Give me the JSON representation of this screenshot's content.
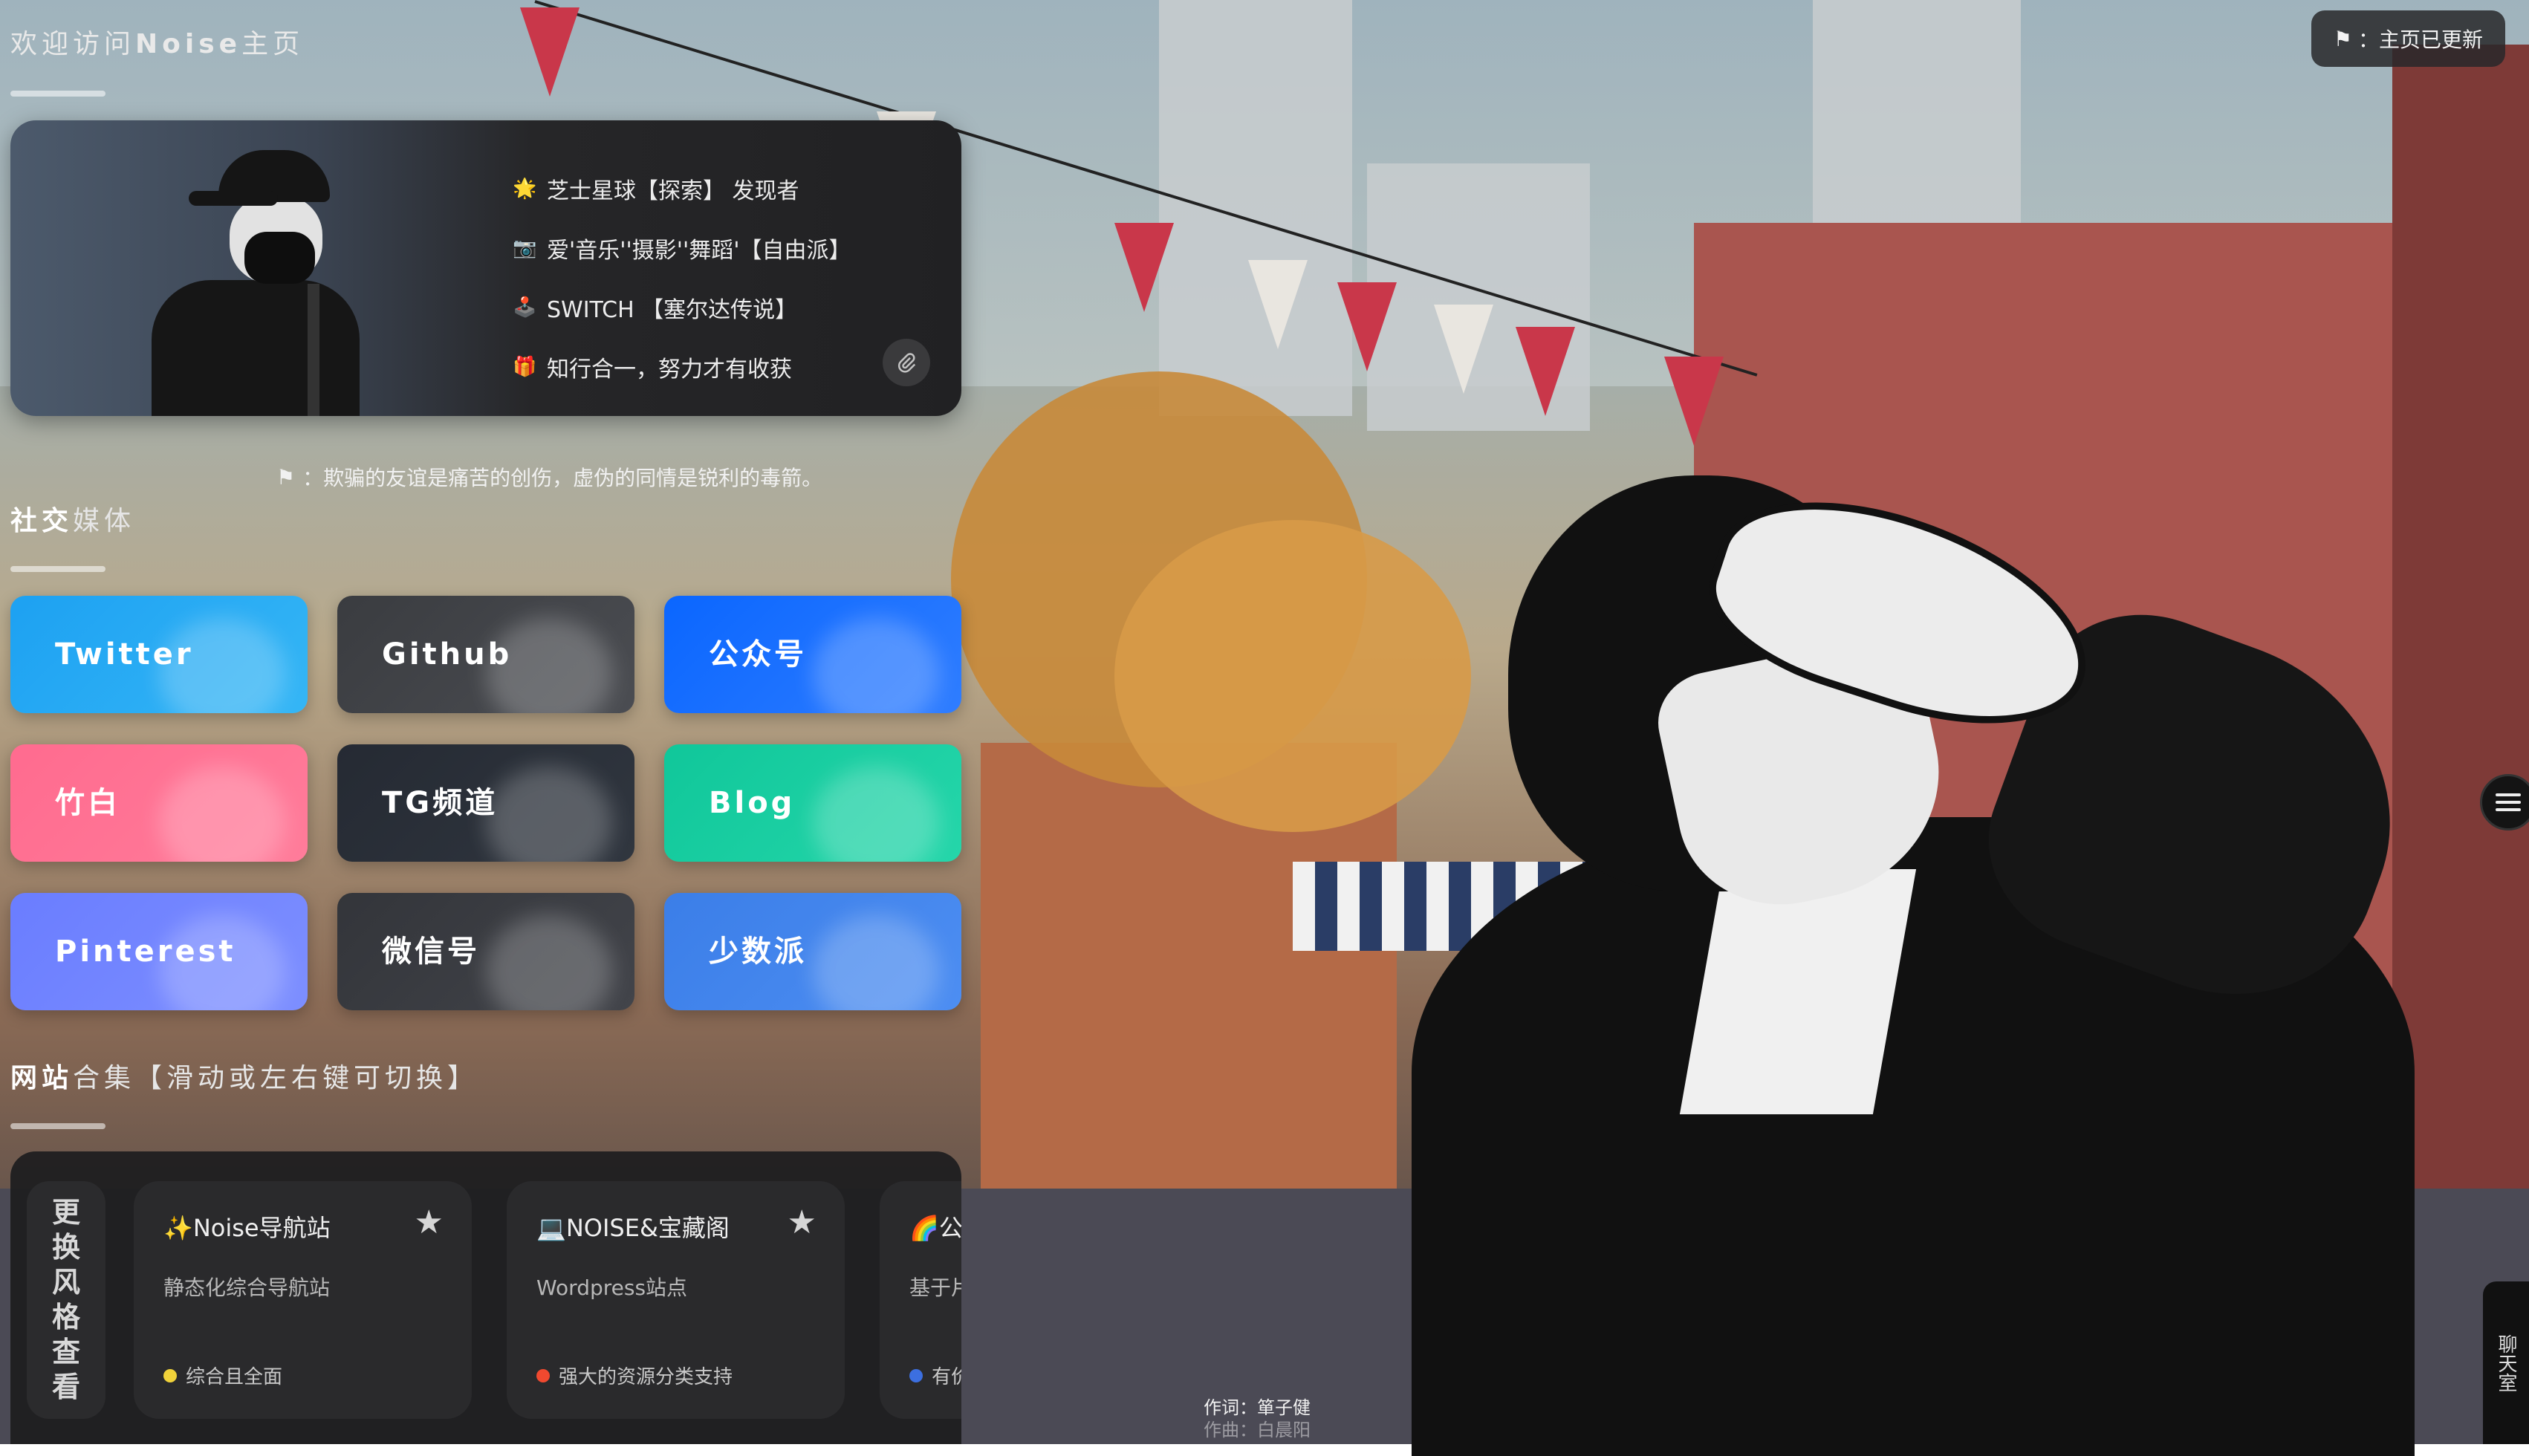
{
  "header": {
    "title_prefix": "欢迎访问",
    "title_brand": "Noise",
    "title_suffix": "主页"
  },
  "profile": {
    "lines": [
      {
        "emoji": "🌟",
        "text": "芝士星球【探索】 发现者"
      },
      {
        "emoji": "📷",
        "text": "爱'音乐''摄影''舞蹈'【自由派】"
      },
      {
        "emoji": "🕹️",
        "text": "SWITCH 【塞尔达传说】"
      },
      {
        "emoji": "🎁",
        "text": "知行合一，努力才有收获"
      }
    ],
    "link_icon": "paperclip-icon"
  },
  "quote": {
    "icon": "flag-icon",
    "text": "：欺骗的友谊是痛苦的创伤，虚伪的同情是锐利的毒箭。"
  },
  "social": {
    "title_bold": "社交",
    "title_rest": "媒体",
    "items": [
      {
        "label": "Twitter",
        "color": "#1da1f2",
        "color2": "#35b6f5"
      },
      {
        "label": "Github",
        "color": "#3a3c40",
        "color2": "#4b4d52"
      },
      {
        "label": "公众号",
        "color": "#0a66ff",
        "color2": "#2f7dff"
      },
      {
        "label": "竹白",
        "color": "#ff6b8f",
        "color2": "#ff7c9a"
      },
      {
        "label": "TG频道",
        "color": "#252a33",
        "color2": "#30363f"
      },
      {
        "label": "Blog",
        "color": "#10c79a",
        "color2": "#25d6aa"
      },
      {
        "label": "Pinterest",
        "color": "#6a7dff",
        "color2": "#7d8fff"
      },
      {
        "label": "微信号",
        "color": "#33353a",
        "color2": "#42444a"
      },
      {
        "label": "少数派",
        "color": "#3b7ee8",
        "color2": "#4d8ef2"
      }
    ]
  },
  "sites": {
    "title_bold": "网站",
    "title_rest": "合集【滑动或左右键可切换】",
    "style_switch": [
      "更",
      "换",
      "风",
      "格",
      "查",
      "看"
    ],
    "cards": [
      {
        "name": "✨Noise导航站",
        "desc": "静态化综合导航站",
        "tag": "综合且全面",
        "dot_color": "#f0d23a"
      },
      {
        "name": "💻NOISE&宝藏阁",
        "desc": "Wordpress站点",
        "tag": "强大的资源分类支持",
        "dot_color": "#f0492f"
      },
      {
        "name": "🌈公",
        "desc": "基于片",
        "tag": "有价",
        "dot_color": "#3c6fe0"
      }
    ]
  },
  "update_badge": {
    "icon": "flag-icon",
    "text": "：主页已更新"
  },
  "chatroom": {
    "label": "聊天室"
  },
  "lyrics": {
    "line1": "作词：箪子健",
    "line2": "作曲：白晨阳"
  }
}
